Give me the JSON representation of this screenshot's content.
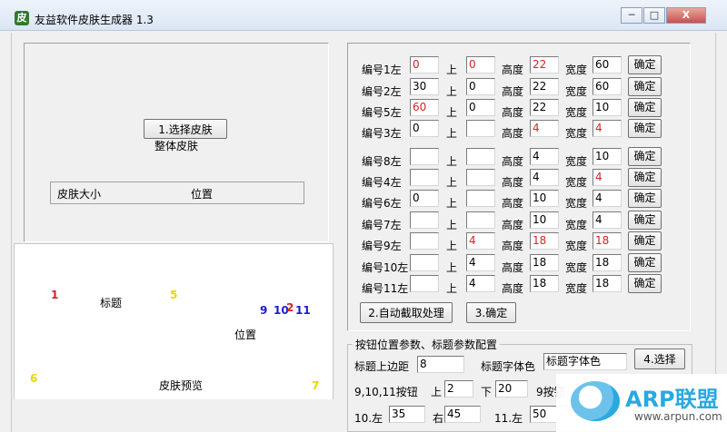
{
  "window": {
    "title": "友益软件皮肤生成器 1.3",
    "buttons": {
      "minimize": "─",
      "maximize": "□",
      "close": "X"
    },
    "app_icon_glyph": "皮"
  },
  "left_top": {
    "select_skin_button": "1.选择皮肤",
    "whole_skin_label": "整体皮肤",
    "size_label": "皮肤大小",
    "position_label": "位置"
  },
  "preview": {
    "markers": {
      "m1": "1",
      "title": "标题",
      "m5": "5",
      "m9": "9",
      "m10": "10",
      "m2": "2",
      "m11": "11",
      "position": "位置",
      "m6": "6",
      "skin_preview": "皮肤预览",
      "m7": "7"
    },
    "colors": {
      "red": "#d42424",
      "yellow": "#e8d800",
      "blue": "#1a1ad0"
    }
  },
  "grid": {
    "labels": {
      "top": "上",
      "height": "高度",
      "width": "宽度",
      "confirm": "确定"
    },
    "rows": [
      {
        "label": "编号1左",
        "left": "0",
        "top": "0",
        "height": "22",
        "width": "60",
        "red": [
          "left",
          "top",
          "height"
        ]
      },
      {
        "label": "编号2左",
        "left": "30",
        "top": "0",
        "height": "22",
        "width": "60",
        "red": []
      },
      {
        "label": "编号5左",
        "left": "60",
        "top": "0",
        "height": "22",
        "width": "10",
        "red": [
          "left"
        ]
      },
      {
        "label": "编号3左",
        "left": "0",
        "top": "",
        "height": "4",
        "width": "4",
        "red": [
          "height",
          "width"
        ]
      },
      {
        "label": "编号8左",
        "left": "",
        "top": "",
        "height": "4",
        "width": "10",
        "red": []
      },
      {
        "label": "编号4左",
        "left": "",
        "top": "",
        "height": "4",
        "width": "4",
        "red": [
          "width"
        ]
      },
      {
        "label": "编号6左",
        "left": "0",
        "top": "",
        "height": "10",
        "width": "4",
        "red": []
      },
      {
        "label": "编号7左",
        "left": "",
        "top": "",
        "height": "10",
        "width": "4",
        "red": []
      },
      {
        "label": "编号9左",
        "left": "",
        "top": "4",
        "height": "18",
        "width": "18",
        "red": [
          "top",
          "height",
          "width"
        ]
      },
      {
        "label": "编号10左",
        "left": "",
        "top": "4",
        "height": "18",
        "width": "18",
        "red": []
      },
      {
        "label": "编号11左",
        "left": "",
        "top": "4",
        "height": "18",
        "width": "18",
        "red": []
      }
    ],
    "auto_button": "2.自动截取处理",
    "confirm3_button": "3.确定"
  },
  "params": {
    "group_title": "按钮位置参数、标题参数配置",
    "title_top_margin_label": "标题上边距",
    "title_top_margin": "8",
    "title_font_color_label": "标题字体色",
    "title_font_color_value": "标题字体色",
    "select4_button": "4.选择",
    "buttons91011_label": "9,10,11按钮",
    "up_label": "上",
    "up_value": "2",
    "down_label": "下",
    "down_value": "20",
    "btn9_label": "9按钮",
    "left10_label": "10.左",
    "left10_value": "35",
    "right_label": "右",
    "right_value": "45",
    "left11_label": "11.左",
    "left11_value": "50"
  },
  "watermark": {
    "brand": "ARP联盟",
    "url": "www.arpun.com"
  }
}
